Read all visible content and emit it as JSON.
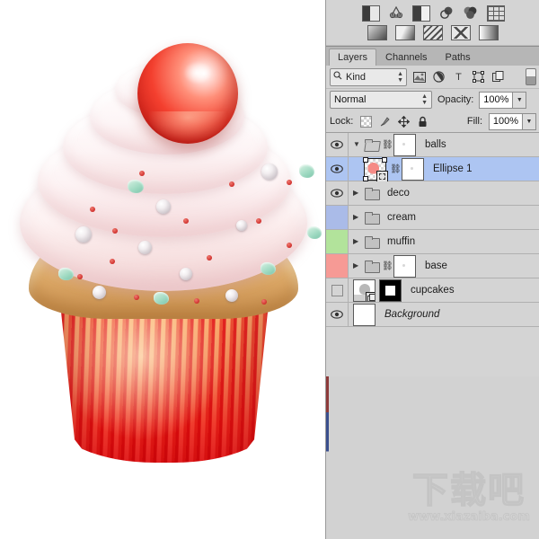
{
  "canvas": {
    "artwork_name": "cupcake-illustration",
    "description": "Cupcake with pink cream swirl, red cherry sphere, pearls and mint sprinkles"
  },
  "adjustments": {
    "row1": [
      "brightness-contrast-icon",
      "levels-icon",
      "curves-icon",
      "exposure-icon",
      "hue-saturation-icon",
      "color-balance-icon"
    ],
    "row2": [
      "black-white-icon",
      "photo-filter-icon",
      "channel-mixer-icon",
      "invert-icon",
      "gradient-map-icon"
    ]
  },
  "tabs": [
    {
      "label": "Layers",
      "active": true
    },
    {
      "label": "Channels",
      "active": false
    },
    {
      "label": "Paths",
      "active": false
    }
  ],
  "filter_bar": {
    "kind_label": "Kind",
    "search_icon": "search-icon",
    "filters": [
      "pixel-layer-icon",
      "adjustment-layer-icon",
      "type-layer-icon",
      "shape-layer-icon",
      "smart-object-icon"
    ],
    "toggle": "filter-toggle-switch"
  },
  "blend_bar": {
    "blend_mode": "Normal",
    "opacity_label": "Opacity:",
    "opacity_value": "100%"
  },
  "lock_bar": {
    "lock_label": "Lock:",
    "icons": [
      "lock-transparent-pixels-icon",
      "lock-image-pixels-icon",
      "lock-position-icon",
      "lock-all-icon"
    ],
    "fill_label": "Fill:",
    "fill_value": "100%"
  },
  "layers": [
    {
      "name": "balls",
      "visible": true,
      "selected": false,
      "type": "group",
      "expanded": true,
      "indent": 0,
      "color_label": "",
      "has_link": true,
      "thumbs": [
        "mask"
      ]
    },
    {
      "name": "Ellipse 1",
      "visible": true,
      "selected": true,
      "type": "shape",
      "expanded": false,
      "indent": 1,
      "color_label": "",
      "has_link": true,
      "thumbs": [
        "vector",
        "mask"
      ]
    },
    {
      "name": "deco",
      "visible": true,
      "selected": false,
      "type": "group",
      "expanded": false,
      "indent": 0,
      "color_label": "",
      "has_link": false,
      "thumbs": []
    },
    {
      "name": "cream",
      "visible": true,
      "selected": false,
      "type": "group",
      "expanded": false,
      "indent": 0,
      "color_label": "#aabbe8",
      "has_link": false,
      "thumbs": []
    },
    {
      "name": "muffin",
      "visible": true,
      "selected": false,
      "type": "group",
      "expanded": false,
      "indent": 0,
      "color_label": "#b2e39b",
      "has_link": false,
      "thumbs": []
    },
    {
      "name": "base",
      "visible": true,
      "selected": false,
      "type": "group",
      "expanded": false,
      "indent": 0,
      "color_label": "#f69a95",
      "has_link": true,
      "thumbs": [
        "mask"
      ]
    },
    {
      "name": "cupcakes",
      "visible": false,
      "selected": false,
      "type": "smart-object",
      "expanded": false,
      "indent": 0,
      "color_label": "",
      "has_link": false,
      "thumbs": [
        "smart",
        "black-mask"
      ]
    },
    {
      "name": "Background",
      "visible": true,
      "selected": false,
      "type": "background",
      "expanded": false,
      "indent": 0,
      "color_label": "",
      "has_link": false,
      "thumbs": [
        "white"
      ]
    }
  ],
  "watermark": {
    "text": "下载吧",
    "url": "www.xiazaiba.com"
  },
  "colors": {
    "panel_bg": "#d4d4d4",
    "selected_row": "#adc5f2",
    "label_blue": "#aabbe8",
    "label_green": "#b2e39b",
    "label_red": "#f69a95"
  }
}
